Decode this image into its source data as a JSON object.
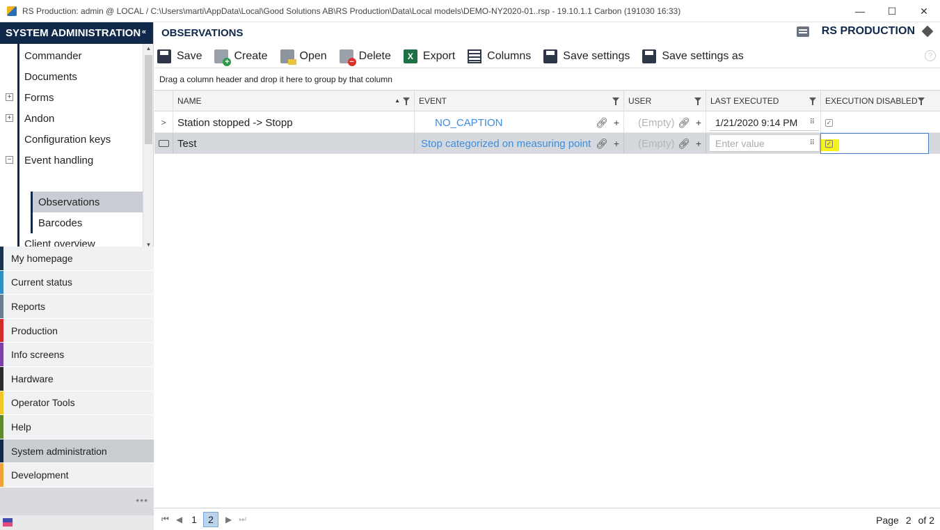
{
  "window": {
    "title": "RS Production: admin @ LOCAL / C:\\Users\\marti\\AppData\\Local\\Good Solutions AB\\RS Production\\Data\\Local models\\DEMO-NY2020-01..rsp - 19.10.1.1 Carbon (191030 16:33)",
    "minimize": "—",
    "maximize": "☐",
    "close": "✕"
  },
  "sidebar": {
    "header": "SYSTEM ADMINISTRATION",
    "collapse_icon": "«",
    "tree": [
      {
        "label": "Commander"
      },
      {
        "label": "Documents"
      },
      {
        "label": "Forms",
        "expander": "+"
      },
      {
        "label": "Andon",
        "expander": "+"
      },
      {
        "label": "Configuration keys"
      },
      {
        "label": "Event handling",
        "expander": "−"
      },
      {
        "label": "Observations"
      },
      {
        "label": "Barcodes"
      },
      {
        "label": "Client overview"
      }
    ],
    "nav": [
      {
        "label": "My homepage",
        "color": "#1b3550"
      },
      {
        "label": "Current status",
        "color": "#2f8fc4"
      },
      {
        "label": "Reports",
        "color": "#6b7d8c"
      },
      {
        "label": "Production",
        "color": "#d42a2a"
      },
      {
        "label": "Info screens",
        "color": "#7b3fa8"
      },
      {
        "label": "Hardware",
        "color": "#2c2c2c"
      },
      {
        "label": "Operator Tools",
        "color": "#f0c929"
      },
      {
        "label": "Help",
        "color": "#5d8a2a"
      },
      {
        "label": "System administration",
        "color": "#10294a"
      },
      {
        "label": "Development",
        "color": "#f0a23a"
      }
    ],
    "more": "•••"
  },
  "main": {
    "title": "OBSERVATIONS",
    "brand": "RS PRODUCTION"
  },
  "toolbar": {
    "save": "Save",
    "create": "Create",
    "open": "Open",
    "delete": "Delete",
    "export": "Export",
    "columns": "Columns",
    "save_settings": "Save settings",
    "save_settings_as": "Save settings as",
    "help": "?"
  },
  "group_hint": "Drag a column header and drop it here to group by that column",
  "grid": {
    "headers": {
      "name": "NAME",
      "event": "EVENT",
      "user": "USER",
      "last_executed": "LAST EXECUTED",
      "execution_disabled": "EXECUTION DISABLED"
    },
    "rows": [
      {
        "indicator": ">",
        "name": "Station stopped -> Stopp",
        "event": "NO_CAPTION",
        "user": "(Empty)",
        "last_executed": "1/21/2020 9:14 PM",
        "execution_disabled": "✓"
      },
      {
        "name": "Test",
        "event": "Stop categorized on measuring point",
        "user": "(Empty)",
        "last_executed_placeholder": "Enter value",
        "execution_disabled": "✓"
      }
    ]
  },
  "pager": {
    "first": "⏮",
    "prev": "◀",
    "pages": [
      "1",
      "2"
    ],
    "current": "2",
    "next": "▶",
    "last": "⏭",
    "page_label": "Page",
    "page_value": "2",
    "of_label": "of 2"
  },
  "colors": {
    "navy": "#10294a",
    "link": "#3b8de0",
    "highlight": "#f5f21d"
  }
}
